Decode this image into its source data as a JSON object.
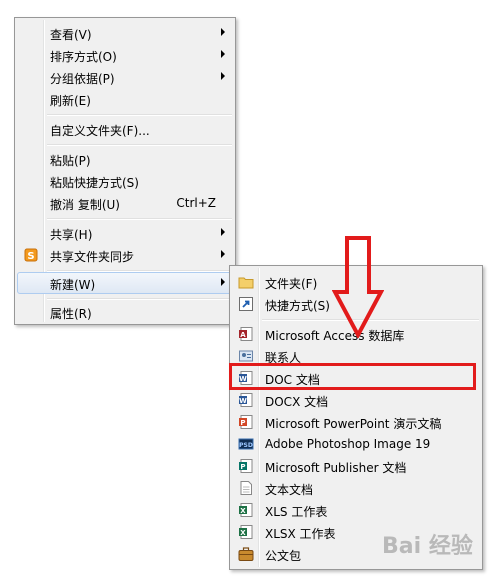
{
  "main_menu": {
    "view": "查看(V)",
    "sort": "排序方式(O)",
    "group": "分组依据(P)",
    "refresh": "刷新(E)",
    "customize": "自定义文件夹(F)...",
    "paste": "粘贴(P)",
    "paste_shortcut": "粘贴快捷方式(S)",
    "undo": "撤消 复制(U)",
    "undo_shortcut": "Ctrl+Z",
    "share": "共享(H)",
    "sync": "共享文件夹同步",
    "new": "新建(W)",
    "properties": "属性(R)"
  },
  "new_submenu": {
    "folder": "文件夹(F)",
    "shortcut": "快捷方式(S)",
    "access": "Microsoft Access 数据库",
    "contact": "联系人",
    "doc": "DOC 文档",
    "docx": "DOCX 文档",
    "ppt": "Microsoft PowerPoint 演示文稿",
    "psd": "Adobe Photoshop Image 19",
    "publisher": "Microsoft Publisher 文档",
    "text": "文本文档",
    "xls": "XLS 工作表",
    "xlsx": "XLSX 工作表",
    "briefcase": "公文包"
  },
  "watermark": "Bai 经验",
  "colors": {
    "highlight_box": "#e21b1b",
    "menu_bg": "#f0f0f0"
  }
}
